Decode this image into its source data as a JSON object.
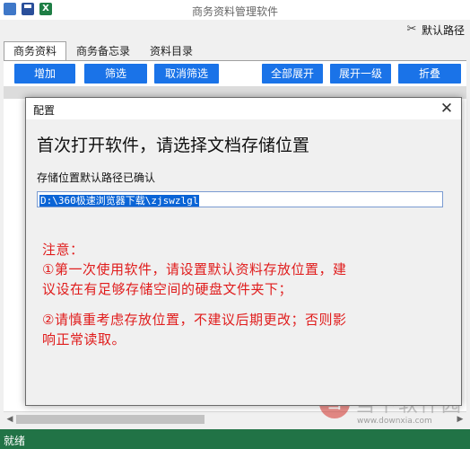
{
  "window": {
    "title": "商务资料管理软件"
  },
  "toolbar": {
    "default_path_label": "默认路径"
  },
  "tabs": [
    {
      "label": "商务资料",
      "active": true
    },
    {
      "label": "商务备忘录",
      "active": false
    },
    {
      "label": "资料目录",
      "active": false
    }
  ],
  "buttons": {
    "add": "增加",
    "filter": "筛选",
    "cancel_filter": "取消筛选",
    "expand_all": "全部展开",
    "expand_level1": "展开一级",
    "collapse": "折叠"
  },
  "status": {
    "text": "就绪"
  },
  "watermark": {
    "logo": "当",
    "text": "当下软件园",
    "url": "www.downxia.com"
  },
  "dialog": {
    "title": "配置",
    "heading": "首次打开软件，请选择文档存储位置",
    "path_label": "存储位置默认路径已确认",
    "path_value": "D:\\360极速浏览器下载\\zjswzlgl",
    "notes": [
      "注意：",
      "①第一次使用软件，请设置默认资料存放位置，建",
      "议设在有足够存储空间的硬盘文件夹下；",
      "②请慎重考虑存放位置，不建议后期更改；否则影",
      "响正常读取。"
    ]
  },
  "colors": {
    "accent_button": "#1a73e8",
    "status_bar": "#217346",
    "note_text": "#e01c1c"
  }
}
